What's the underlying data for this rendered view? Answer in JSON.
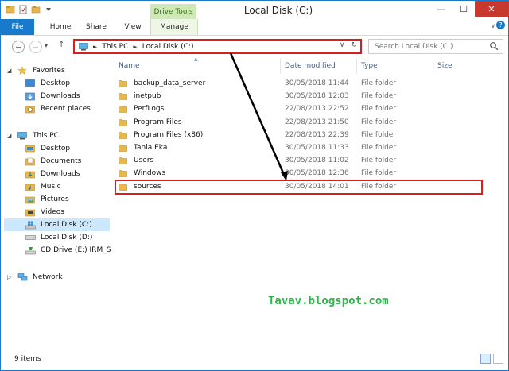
{
  "window": {
    "title": "Local Disk (C:)",
    "context_tab": "Drive Tools"
  },
  "ribbon": {
    "tabs": [
      {
        "label": "File"
      },
      {
        "label": "Home"
      },
      {
        "label": "Share"
      },
      {
        "label": "View"
      },
      {
        "label": "Manage"
      }
    ]
  },
  "address": {
    "root": "This PC",
    "current": "Local Disk (C:)"
  },
  "search": {
    "placeholder": "Search Local Disk (C:)"
  },
  "columns": {
    "name": "Name",
    "date": "Date modified",
    "type": "Type",
    "size": "Size"
  },
  "nav": {
    "favorites": "Favorites",
    "favorite_items": [
      "Desktop",
      "Downloads",
      "Recent places"
    ],
    "this_pc": "This PC",
    "pc_items": [
      "Desktop",
      "Documents",
      "Downloads",
      "Music",
      "Pictures",
      "Videos",
      "Local Disk (C:)",
      "Local Disk (D:)",
      "CD Drive (E:) IRM_SS"
    ],
    "network": "Network"
  },
  "files": [
    {
      "name": "backup_data_server",
      "date": "30/05/2018 11:44",
      "type": "File folder"
    },
    {
      "name": "inetpub",
      "date": "30/05/2018 12:03",
      "type": "File folder"
    },
    {
      "name": "PerfLogs",
      "date": "22/08/2013 22:52",
      "type": "File folder"
    },
    {
      "name": "Program Files",
      "date": "22/08/2013 21:50",
      "type": "File folder"
    },
    {
      "name": "Program Files (x86)",
      "date": "22/08/2013 22:39",
      "type": "File folder"
    },
    {
      "name": "Tania Eka",
      "date": "30/05/2018 11:33",
      "type": "File folder"
    },
    {
      "name": "Users",
      "date": "30/05/2018 11:02",
      "type": "File folder"
    },
    {
      "name": "Windows",
      "date": "30/05/2018 12:36",
      "type": "File folder"
    },
    {
      "name": "sources",
      "date": "30/05/2018 14:01",
      "type": "File folder"
    }
  ],
  "status": {
    "item_count": "9 items"
  },
  "watermark": "Tavav.blogspot.com",
  "colors": {
    "accent": "#1979ca",
    "highlight": "#e01b1b",
    "selected": "#cce8ff",
    "watermark": "#2bb54a",
    "folder": "#e8b84a"
  }
}
